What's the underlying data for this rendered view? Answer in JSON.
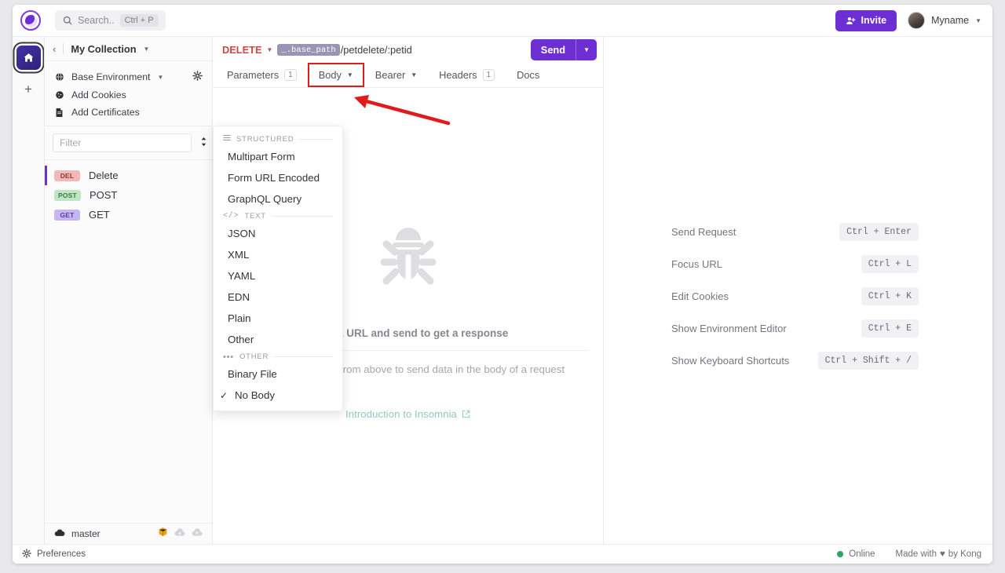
{
  "topbar": {
    "search_placeholder": "Search..",
    "search_shortcut": "Ctrl + P",
    "invite_label": "Invite",
    "user_name": "Myname"
  },
  "rail": {
    "home_title": "home-workspace",
    "add_label": "+"
  },
  "sidebar": {
    "collection_title": "My Collection",
    "environment": {
      "label": "Base Environment",
      "cookies_label": "Add Cookies",
      "certificates_label": "Add Certificates"
    },
    "filter_placeholder": "Filter",
    "requests": [
      {
        "method": "DEL",
        "name": "Delete",
        "method_class": "m-del",
        "active": true
      },
      {
        "method": "POST",
        "name": "POST",
        "method_class": "m-post",
        "active": false
      },
      {
        "method": "GET",
        "name": "GET",
        "method_class": "m-get",
        "active": false
      }
    ],
    "branch": "master"
  },
  "request": {
    "method": "DELETE",
    "url_template_tag": "_.base_path",
    "url_path": "/petdelete/:petid",
    "send_label": "Send",
    "tabs": [
      {
        "label": "Parameters",
        "badge": "1",
        "caret": false,
        "highlighted": false
      },
      {
        "label": "Body",
        "badge": "",
        "caret": true,
        "highlighted": true
      },
      {
        "label": "Bearer",
        "badge": "",
        "caret": true,
        "highlighted": false
      },
      {
        "label": "Headers",
        "badge": "1",
        "caret": false,
        "highlighted": false
      },
      {
        "label": "Docs",
        "badge": "",
        "caret": false,
        "highlighted": false
      }
    ]
  },
  "body_menu": {
    "sections": [
      {
        "title": "STRUCTURED",
        "icon": "list-icon",
        "items": [
          {
            "label": "Multipart Form",
            "checked": false
          },
          {
            "label": "Form URL Encoded",
            "checked": false
          },
          {
            "label": "GraphQL Query",
            "checked": false
          }
        ]
      },
      {
        "title": "TEXT",
        "icon": "code-icon",
        "items": [
          {
            "label": "JSON",
            "checked": false
          },
          {
            "label": "XML",
            "checked": false
          },
          {
            "label": "YAML",
            "checked": false
          },
          {
            "label": "EDN",
            "checked": false
          },
          {
            "label": "Plain",
            "checked": false
          },
          {
            "label": "Other",
            "checked": false
          }
        ]
      },
      {
        "title": "OTHER",
        "icon": "ellipsis-icon",
        "items": [
          {
            "label": "Binary File",
            "checked": false
          },
          {
            "label": "No Body",
            "checked": true
          }
        ]
      }
    ]
  },
  "empty_state": {
    "line1": "Enter a URL and send to get a response",
    "line2": "Select a body type from above to send data in the body of a request",
    "link": "Introduction to Insomnia"
  },
  "shortcuts": [
    {
      "label": "Send Request",
      "keys": "Ctrl + Enter"
    },
    {
      "label": "Focus URL",
      "keys": "Ctrl + L"
    },
    {
      "label": "Edit Cookies",
      "keys": "Ctrl + K"
    },
    {
      "label": "Show Environment Editor",
      "keys": "Ctrl + E"
    },
    {
      "label": "Show Keyboard Shortcuts",
      "keys": "Ctrl + Shift + /"
    }
  ],
  "statusbar": {
    "preferences_label": "Preferences",
    "online_label": "Online",
    "made_with_prefix": "Made with",
    "made_with_suffix": "by Kong"
  },
  "colors": {
    "accent": "#6d2fd4",
    "delete_method": "#d04545",
    "highlight_box": "#e01b1b",
    "online": "#2aa85a",
    "link": "#93c9c4"
  }
}
